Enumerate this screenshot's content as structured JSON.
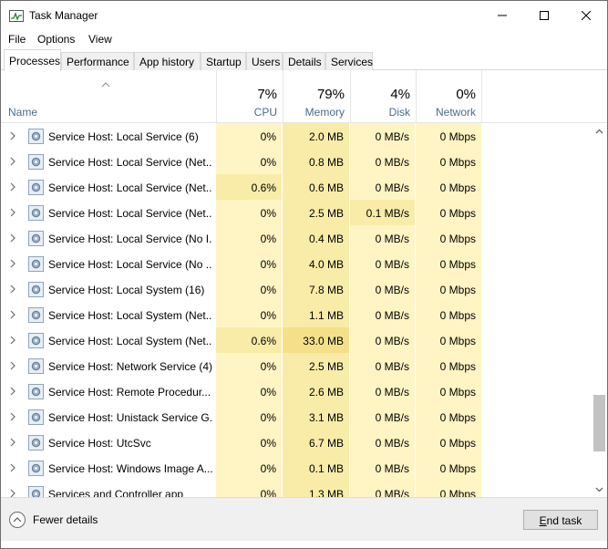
{
  "window": {
    "title": "Task Manager",
    "icon": "task-manager-icon"
  },
  "menu": [
    "File",
    "Options",
    "View"
  ],
  "tabs": [
    {
      "label": "Processes",
      "active": true
    },
    {
      "label": "Performance",
      "active": false
    },
    {
      "label": "App history",
      "active": false
    },
    {
      "label": "Startup",
      "active": false
    },
    {
      "label": "Users",
      "active": false
    },
    {
      "label": "Details",
      "active": false
    },
    {
      "label": "Services",
      "active": false
    }
  ],
  "columns": {
    "name": "Name",
    "cpu": {
      "pct": "7%",
      "label": "CPU"
    },
    "memory": {
      "pct": "79%",
      "label": "Memory"
    },
    "disk": {
      "pct": "4%",
      "label": "Disk"
    },
    "network": {
      "pct": "0%",
      "label": "Network"
    }
  },
  "processes": [
    {
      "name": "Service Host: Local Service (6)",
      "cpu": "0%",
      "memory": "2.0 MB",
      "disk": "0 MB/s",
      "network": "0 Mbps"
    },
    {
      "name": "Service Host: Local Service (Net...",
      "cpu": "0%",
      "memory": "0.8 MB",
      "disk": "0 MB/s",
      "network": "0 Mbps"
    },
    {
      "name": "Service Host: Local Service (Net...",
      "cpu": "0.6%",
      "memory": "0.6 MB",
      "disk": "0 MB/s",
      "network": "0 Mbps"
    },
    {
      "name": "Service Host: Local Service (Net...",
      "cpu": "0%",
      "memory": "2.5 MB",
      "disk": "0.1 MB/s",
      "network": "0 Mbps"
    },
    {
      "name": "Service Host: Local Service (No I...",
      "cpu": "0%",
      "memory": "0.4 MB",
      "disk": "0 MB/s",
      "network": "0 Mbps"
    },
    {
      "name": "Service Host: Local Service (No ...",
      "cpu": "0%",
      "memory": "4.0 MB",
      "disk": "0 MB/s",
      "network": "0 Mbps"
    },
    {
      "name": "Service Host: Local System (16)",
      "cpu": "0%",
      "memory": "7.8 MB",
      "disk": "0 MB/s",
      "network": "0 Mbps"
    },
    {
      "name": "Service Host: Local System (Net...",
      "cpu": "0%",
      "memory": "1.1 MB",
      "disk": "0 MB/s",
      "network": "0 Mbps"
    },
    {
      "name": "Service Host: Local System (Net...",
      "cpu": "0.6%",
      "memory": "33.0 MB",
      "disk": "0 MB/s",
      "network": "0 Mbps"
    },
    {
      "name": "Service Host: Network Service (4)",
      "cpu": "0%",
      "memory": "2.5 MB",
      "disk": "0 MB/s",
      "network": "0 Mbps"
    },
    {
      "name": "Service Host: Remote Procedur...",
      "cpu": "0%",
      "memory": "2.6 MB",
      "disk": "0 MB/s",
      "network": "0 Mbps"
    },
    {
      "name": "Service Host: Unistack Service G...",
      "cpu": "0%",
      "memory": "3.1 MB",
      "disk": "0 MB/s",
      "network": "0 Mbps"
    },
    {
      "name": "Service Host: UtcSvc",
      "cpu": "0%",
      "memory": "6.7 MB",
      "disk": "0 MB/s",
      "network": "0 Mbps"
    },
    {
      "name": "Service Host: Windows Image A...",
      "cpu": "0%",
      "memory": "0.1 MB",
      "disk": "0 MB/s",
      "network": "0 Mbps"
    },
    {
      "name": "Services and Controller app",
      "cpu": "0%",
      "memory": "1.3 MB",
      "disk": "0 MB/s",
      "network": "0 Mbps"
    }
  ],
  "footer": {
    "fewer_details": "Fewer details",
    "end_task_prefix": "E",
    "end_task_rest": "nd task"
  },
  "colors": {
    "heat_light": "#fff4c4",
    "heat_medium": "#f9eca8",
    "heat_strong": "#f5e08a",
    "header_label": "#4a6c8c"
  }
}
